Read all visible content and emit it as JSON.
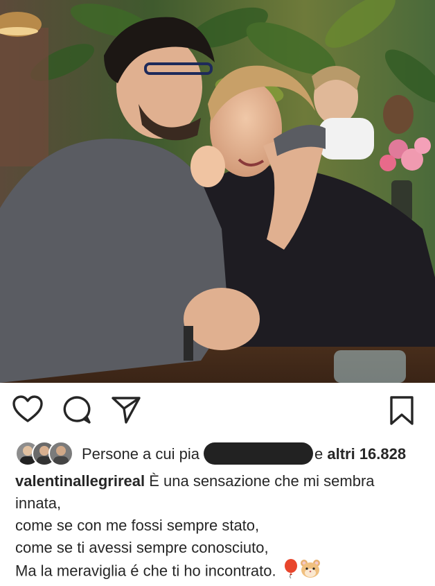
{
  "post": {
    "photo_icon": "photo-couple-restaurant",
    "actions": {
      "like_icon": "heart-icon",
      "comment_icon": "comment-icon",
      "share_icon": "send-icon",
      "save_icon": "bookmark-icon"
    },
    "likes": {
      "prefix": "Persone a cui pia",
      "suffix_pre": "e ",
      "count_text": "altri 16.828"
    },
    "caption": {
      "username": "valentinallegrireal",
      "line1": "È una sensazione che mi sembra",
      "line2": "innata,",
      "line3": "come se con me fossi sempre stato,",
      "line4": "come se ti avessi sempre conosciuto,",
      "line5": "Ma la meraviglia é che ti ho incontrato.",
      "emoji": [
        "balloon-icon",
        "hamster-icon"
      ]
    }
  }
}
